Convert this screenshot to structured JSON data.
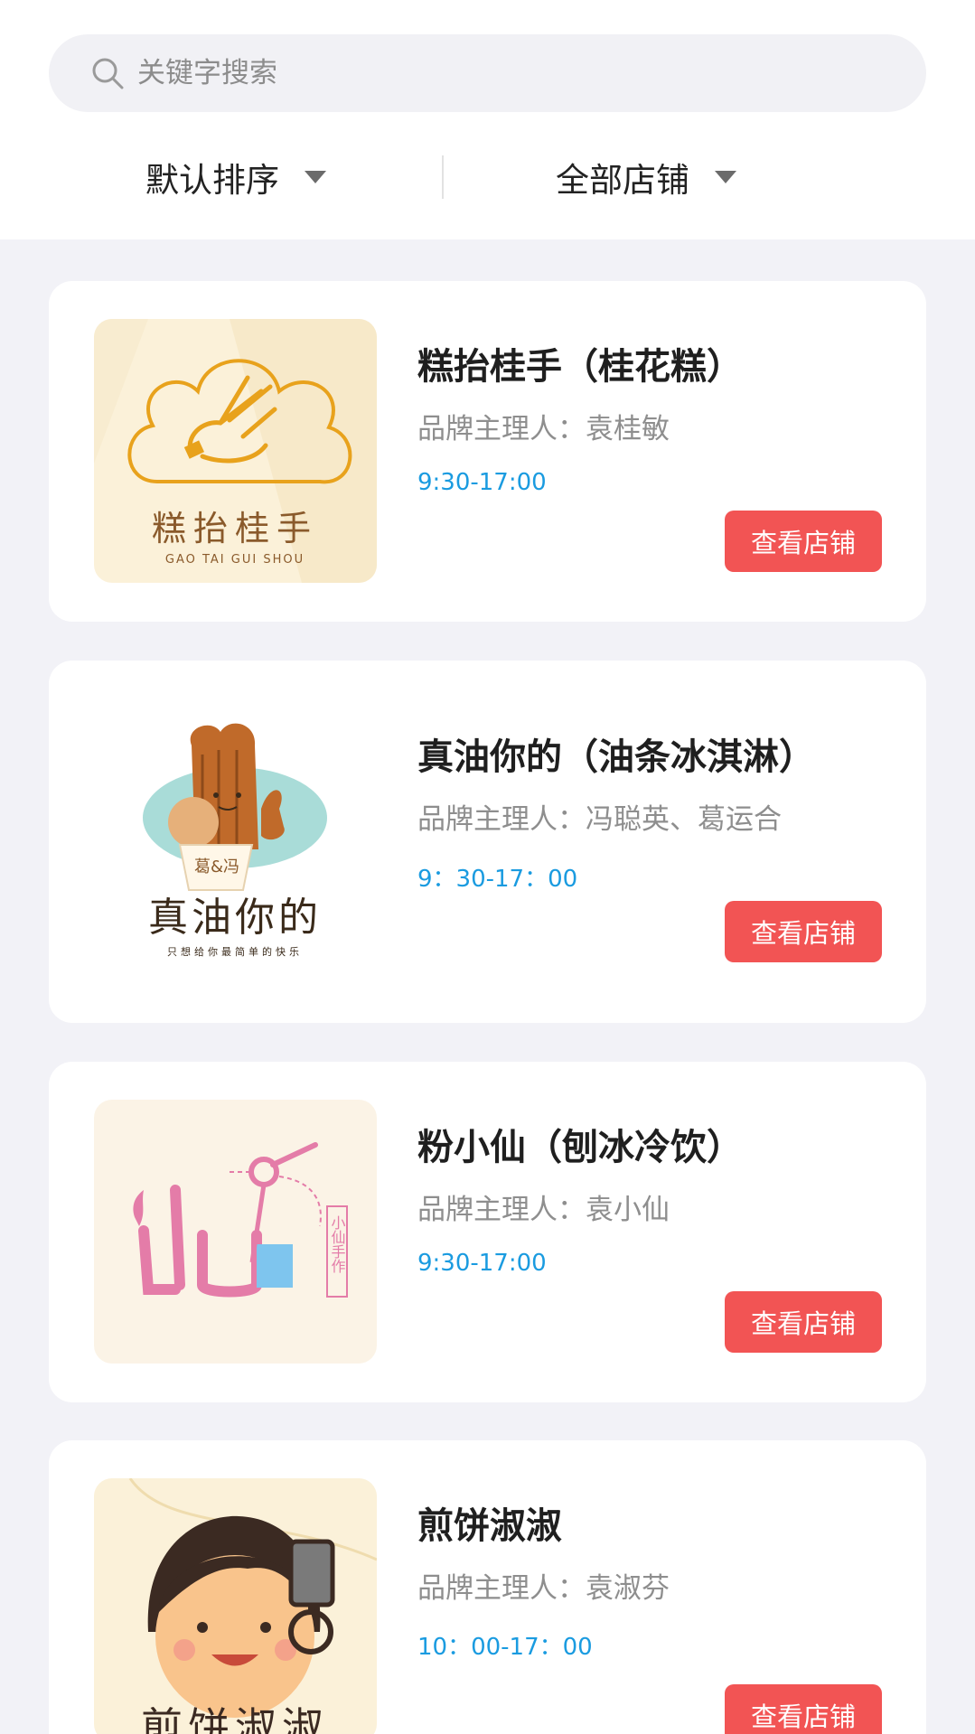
{
  "search": {
    "placeholder": "关键字搜索"
  },
  "filters": {
    "sort_label": "默认排序",
    "shops_label": "全部店铺"
  },
  "shops": [
    {
      "name": "糕抬桂手（桂花糕）",
      "owner_label": "品牌主理人：",
      "owner": "袁桂敏",
      "hours": "9:30-17:00",
      "button": "查看店铺",
      "logo_text": "糕抬桂手",
      "logo_subtext": "GAO TAI GUI SHOU"
    },
    {
      "name": "真油你的（油条冰淇淋）",
      "owner_label": "品牌主理人：",
      "owner": "冯聪英、葛运合",
      "hours": "9：30-17：00",
      "button": "查看店铺",
      "logo_text": "真油你的",
      "logo_subtext": "只想给你最简单的快乐",
      "logo_badge": "葛&冯"
    },
    {
      "name": "粉小仙（刨冰冷饮）",
      "owner_label": "品牌主理人：",
      "owner": "袁小仙",
      "hours": "9:30-17:00",
      "button": "查看店铺",
      "logo_side_text": "小仙手作"
    },
    {
      "name": "煎饼淑淑",
      "owner_label": "品牌主理人：",
      "owner": "袁淑芬",
      "hours": "10：00-17：00",
      "button": "查看店铺",
      "logo_text": "煎饼淑淑"
    }
  ],
  "colors": {
    "accent_button": "#f25454",
    "hours_text": "#1a9be0",
    "page_bg": "#f2f2f7"
  }
}
